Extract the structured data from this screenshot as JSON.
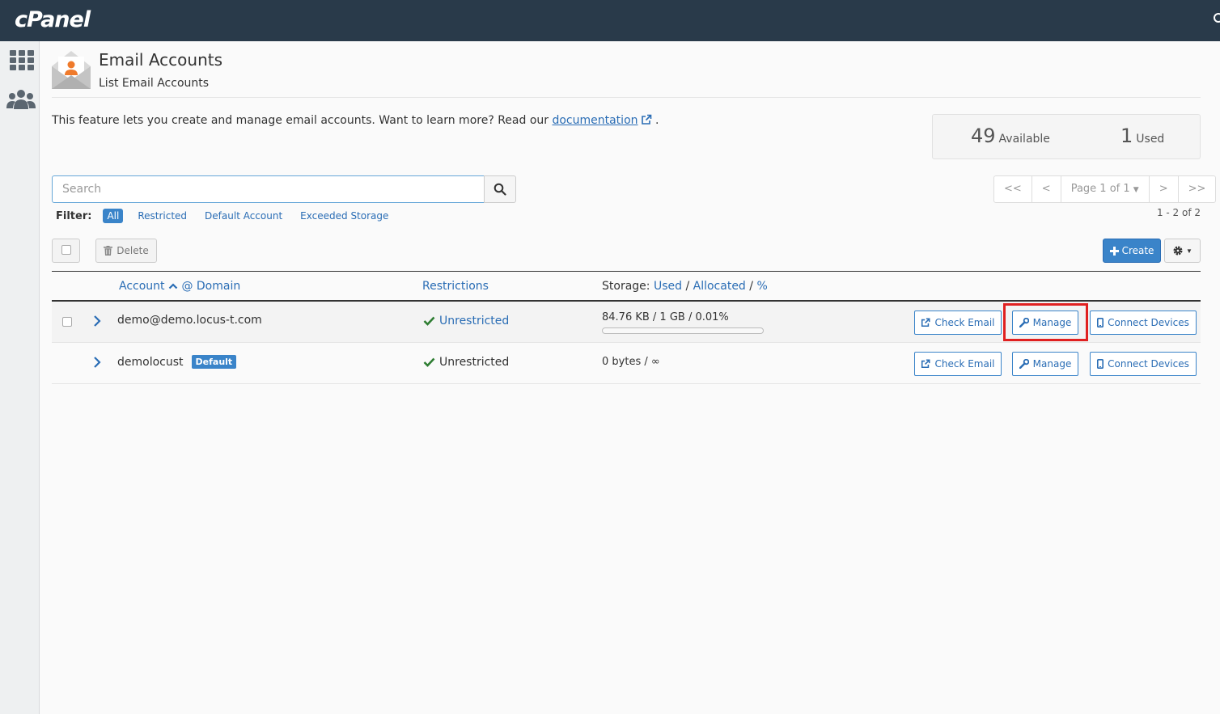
{
  "app": {
    "logo": "cPanel"
  },
  "header": {
    "title": "Email Accounts",
    "subtitle": "List Email Accounts"
  },
  "intro": {
    "text": "This feature lets you create and manage email accounts. Want to learn more? Read our ",
    "link": "documentation",
    "suffix": "."
  },
  "stats": {
    "available_num": "49",
    "available_label": "Available",
    "used_num": "1",
    "used_label": "Used"
  },
  "search": {
    "placeholder": "Search"
  },
  "filter": {
    "label": "Filter:",
    "options": [
      "All",
      "Restricted",
      "Default Account",
      "Exceeded Storage"
    ],
    "active": "All"
  },
  "pager": {
    "first": "<<",
    "prev": "<",
    "page": "Page 1 of 1",
    "next": ">",
    "last": ">>",
    "range": "1 - 2 of 2"
  },
  "toolbar": {
    "delete_label": "Delete",
    "create_label": "Create"
  },
  "columns": {
    "account": "Account",
    "at_domain": "@ Domain",
    "restrictions": "Restrictions",
    "storage_prefix": "Storage:",
    "storage_used": "Used",
    "sep": "/",
    "storage_allocated": "Allocated",
    "storage_pct": "%"
  },
  "rows": [
    {
      "account": "demo@demo.locus-t.com",
      "badge": "",
      "restriction": "Unrestricted",
      "storage": "84.76 KB / 1 GB / 0.01%",
      "usage_fraction": 0.0001
    },
    {
      "account": "demolocust",
      "badge": "Default",
      "restriction": "Unrestricted",
      "storage": "0 bytes / ∞"
    }
  ],
  "actions": {
    "check_email": "Check Email",
    "manage": "Manage",
    "connect_devices": "Connect Devices"
  },
  "colors": {
    "topbar": "#293a4a",
    "accent": "#3a84c9",
    "link": "#2a6db5",
    "check": "#2e7d32",
    "highlight": "#e02020"
  }
}
